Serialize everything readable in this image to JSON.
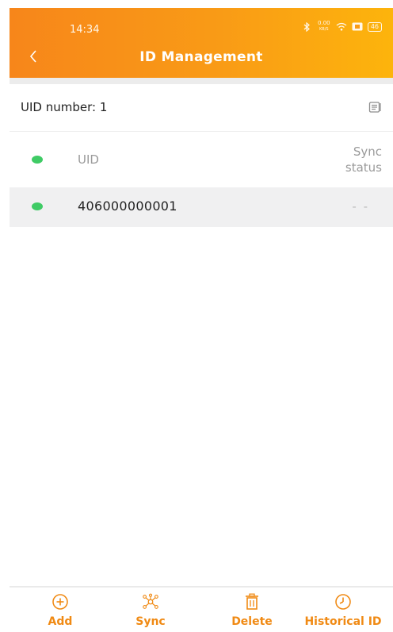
{
  "status_bar": {
    "time": "14:34",
    "net_speed_value": "0.00",
    "net_speed_unit": "KB/S",
    "battery": "46",
    "icons": [
      "bluetooth-icon",
      "wifi-icon",
      "sim-icon",
      "battery-icon"
    ]
  },
  "header": {
    "title": "ID Management",
    "back_icon": "chevron-left-icon"
  },
  "summary": {
    "uid_count_label": "UID number: 1",
    "action_icon": "document-icon"
  },
  "list": {
    "columns": {
      "uid": "UID",
      "sync_line1": "Sync",
      "sync_line2": "status"
    },
    "rows": [
      {
        "uid": "406000000001",
        "sync_status": "- -"
      }
    ]
  },
  "bottom_nav": {
    "items": [
      {
        "label": "Add",
        "icon": "add-circle-icon"
      },
      {
        "label": "Sync",
        "icon": "sync-network-icon"
      },
      {
        "label": "Delete",
        "icon": "trash-icon"
      },
      {
        "label": "Historical ID",
        "icon": "clock-icon"
      }
    ]
  },
  "colors": {
    "accent": "#f08a14",
    "header_gradient_start": "#f7861a",
    "header_gradient_end": "#fdb40c",
    "status_dot": "#3fcb65",
    "row_highlight": "#f0f0f1"
  }
}
